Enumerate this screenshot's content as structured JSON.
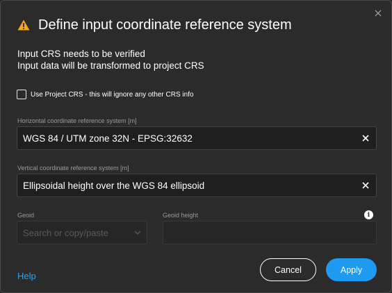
{
  "dialog": {
    "title": "Define input coordinate reference system",
    "title_icon": "warning-icon",
    "close_icon": "close-icon",
    "info_line_1": "Input CRS needs to be verified",
    "info_line_2": "Input data will be transformed to project CRS",
    "use_project_crs": {
      "label": "Use Project CRS - this will ignore any other CRS info",
      "checked": false
    },
    "horizontal": {
      "label": "Horizontal coordinate reference system [m]",
      "value": "WGS 84 / UTM zone 32N - EPSG:32632"
    },
    "vertical": {
      "label": "Vertical coordinate reference system [m]",
      "value": "Ellipsoidal height over the WGS 84 ellipsoid"
    },
    "geoid": {
      "label": "Geoid",
      "placeholder": "Search or copy/paste"
    },
    "geoid_height": {
      "label": "Geoid height",
      "value": "",
      "info_icon": "info-icon"
    },
    "help_label": "Help",
    "cancel_label": "Cancel",
    "apply_label": "Apply"
  },
  "colors": {
    "background": "#2b2b2b",
    "accent": "#1e9bf0",
    "warning": "#f5a623",
    "link": "#2aa3f5"
  }
}
